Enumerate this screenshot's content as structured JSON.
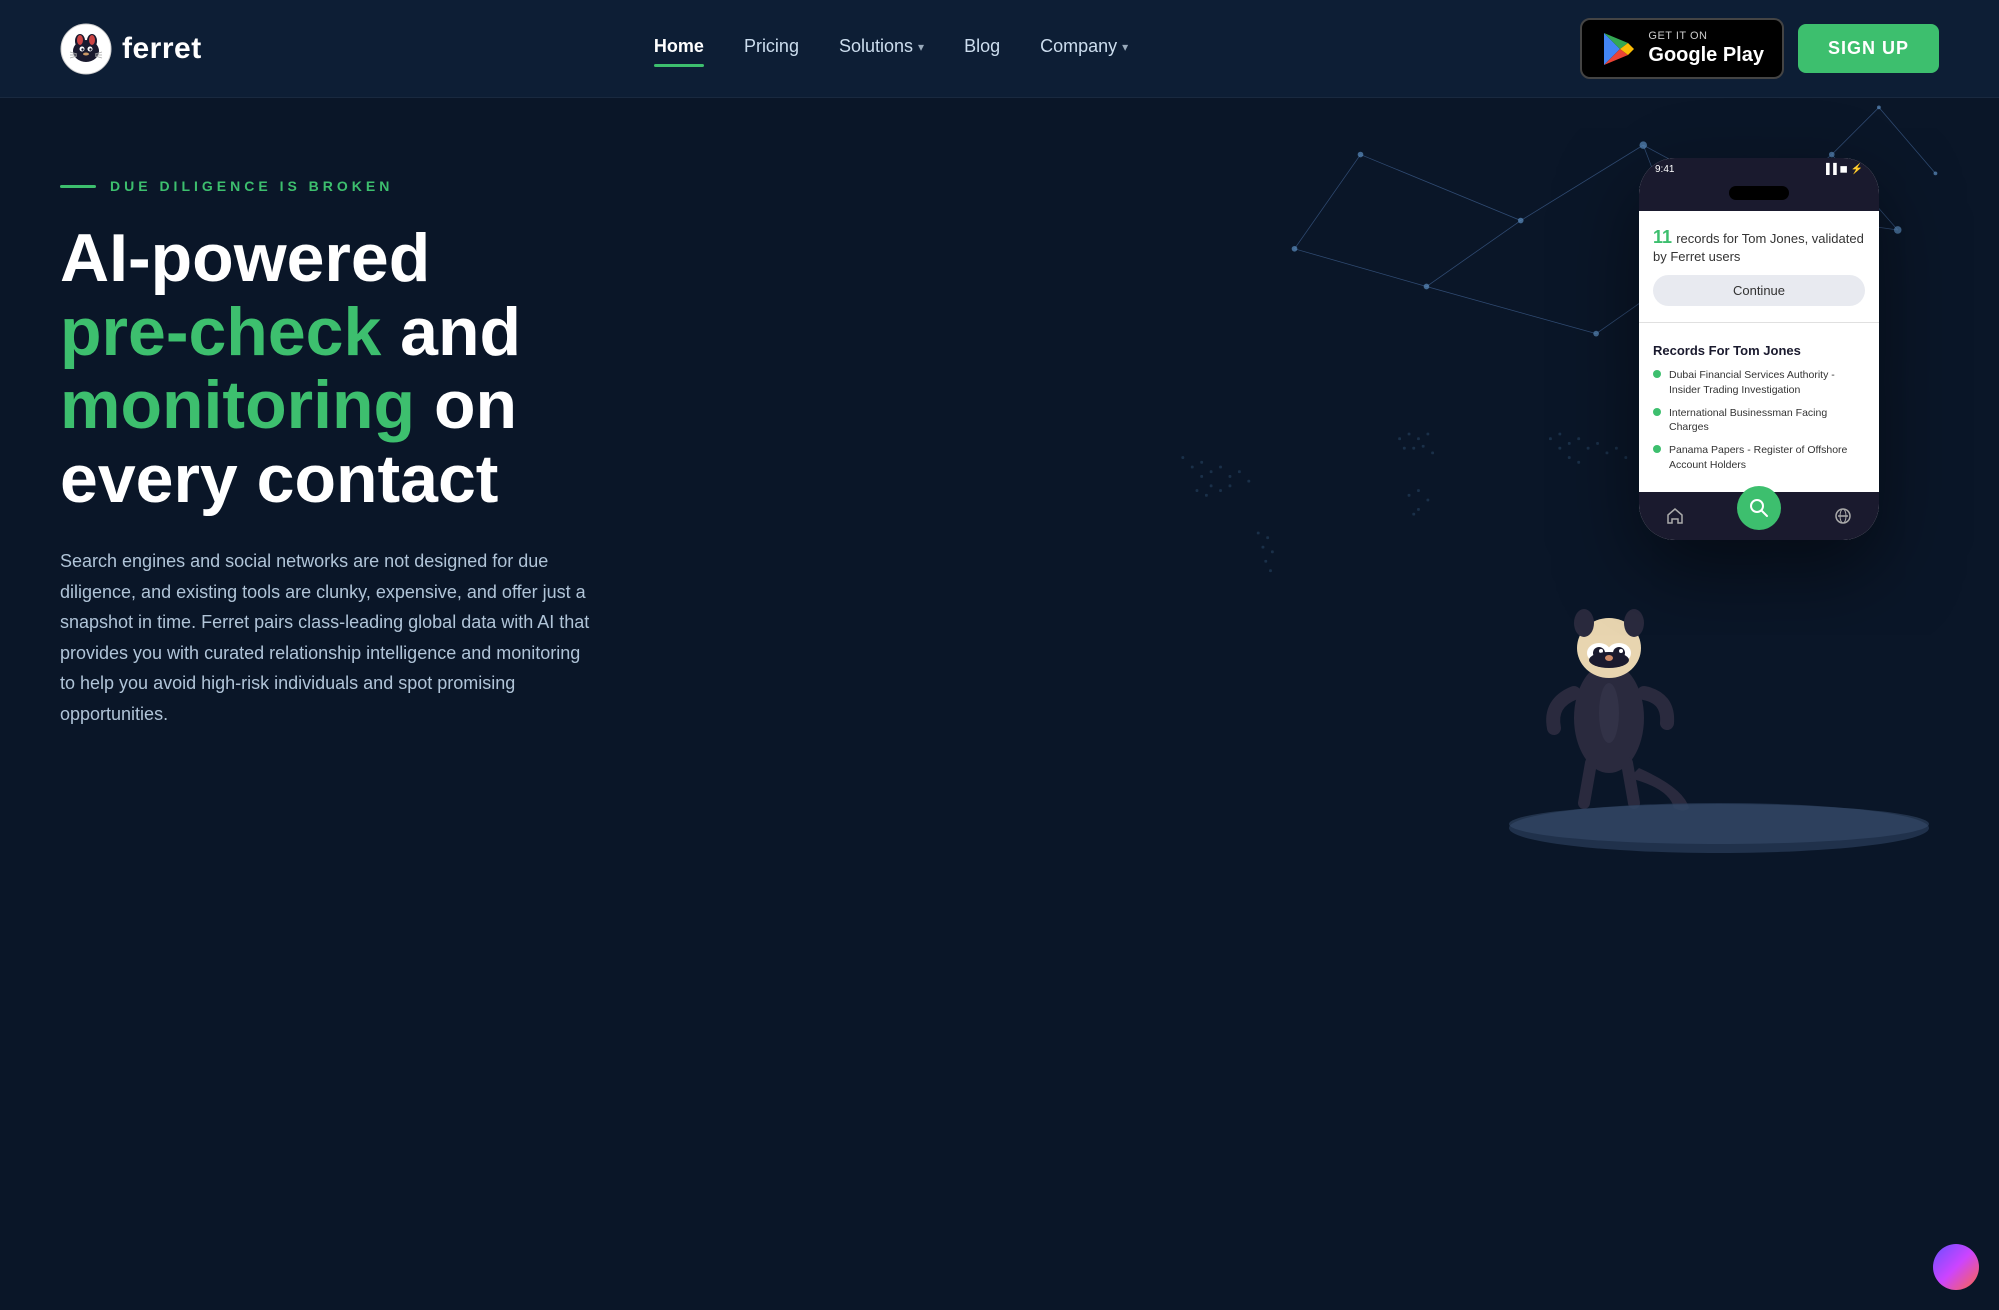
{
  "brand": {
    "name": "ferret",
    "logo_alt": "Ferret logo"
  },
  "nav": {
    "items": [
      {
        "label": "Home",
        "active": true,
        "has_dropdown": false
      },
      {
        "label": "Pricing",
        "active": false,
        "has_dropdown": false
      },
      {
        "label": "Solutions",
        "active": false,
        "has_dropdown": true
      },
      {
        "label": "Blog",
        "active": false,
        "has_dropdown": false
      },
      {
        "label": "Company",
        "active": false,
        "has_dropdown": true
      }
    ]
  },
  "header": {
    "google_play": {
      "get_it": "GET IT ON",
      "store_name": "Google Play"
    },
    "signup_label": "SIGN UP"
  },
  "hero": {
    "tagline": "DUE DILIGENCE IS BROKEN",
    "heading_line1": "AI-powered",
    "heading_line2_green": "pre-check",
    "heading_line2_white": " and",
    "heading_line3_green": "monitoring",
    "heading_line3_white": " on",
    "heading_line4": "every contact",
    "description": "Search engines and social networks are not designed for due diligence, and existing tools are clunky, expensive, and offer just a snapshot in time. Ferret pairs class-leading global data with AI that provides you with curated relationship intelligence and monitoring to help you avoid high-risk individuals and spot promising opportunities."
  },
  "phone": {
    "time": "9:41",
    "top_card": {
      "records_count": "11",
      "records_text": "records for Tom Jones, validated by Ferret users",
      "continue_label": "Continue"
    },
    "bottom_card": {
      "title": "Records For Tom Jones",
      "items": [
        "Dubai Financial Services Authority - Insider Trading Investigation",
        "International Businessman Facing Charges",
        "Panama Papers - Register of Offshore Account Holders"
      ]
    }
  }
}
